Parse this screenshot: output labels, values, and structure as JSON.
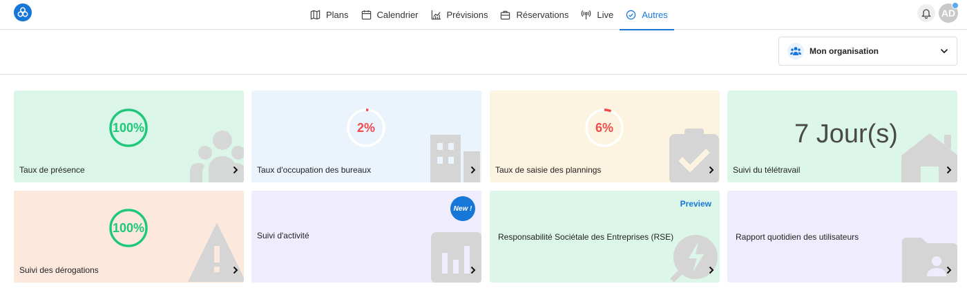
{
  "nav": {
    "items": [
      {
        "label": "Plans",
        "icon": "map-icon"
      },
      {
        "label": "Calendrier",
        "icon": "calendar-icon"
      },
      {
        "label": "Prévisions",
        "icon": "chart-icon"
      },
      {
        "label": "Réservations",
        "icon": "briefcase-icon"
      },
      {
        "label": "Live",
        "icon": "broadcast-icon"
      },
      {
        "label": "Autres",
        "icon": "check-circle-icon"
      }
    ],
    "active": "Autres"
  },
  "user": {
    "initials": "AD"
  },
  "org": {
    "label": "Mon organisation"
  },
  "colors": {
    "accent": "#1677d9",
    "green_gauge": "#1fc77a",
    "red_gauge": "#f04b4b"
  },
  "cards": {
    "presence": {
      "title": "Taux de présence",
      "value": "100%",
      "fraction": 1.0
    },
    "occupation": {
      "title": "Taux d'occupation des bureaux",
      "value": "2%",
      "fraction": 0.02
    },
    "saisie": {
      "title": "Taux de saisie des plannings",
      "value": "6%",
      "fraction": 0.06
    },
    "teletravail": {
      "title": "Suivi du télétravail",
      "value": "7 Jour(s)"
    },
    "derogations": {
      "title": "Suivi des dérogations",
      "value": "100%",
      "fraction": 1.0
    },
    "activite": {
      "title": "Suivi d'activité",
      "badge": "New !"
    },
    "rse": {
      "title": "Responsabilité Sociétale des Entreprises (RSE)",
      "badge": "Preview"
    },
    "rapport": {
      "title": "Rapport quotidien des utilisateurs"
    }
  }
}
